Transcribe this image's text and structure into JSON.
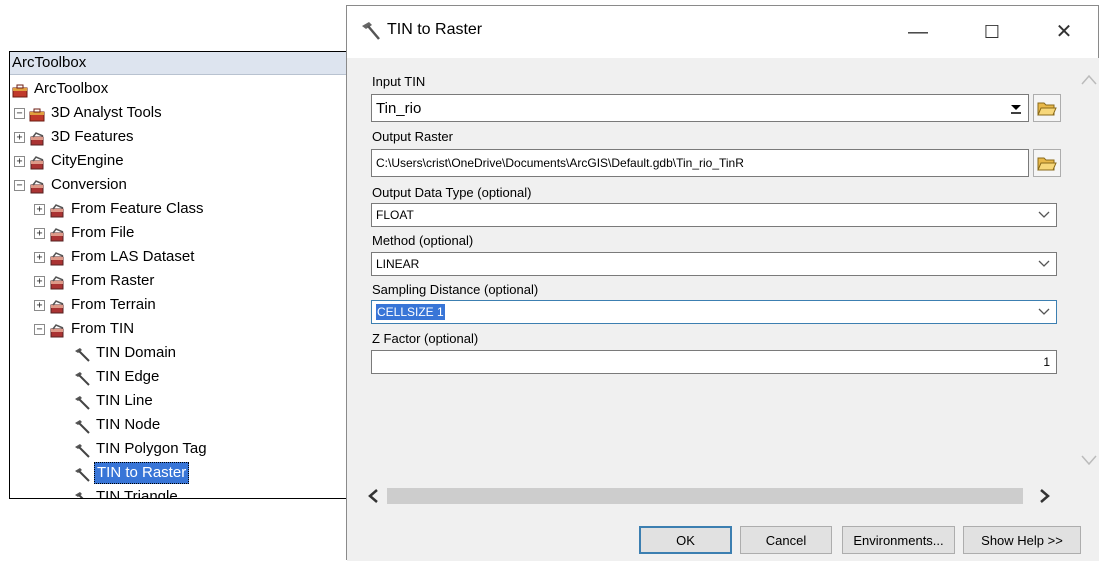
{
  "toolbox": {
    "title": "ArcToolbox",
    "tree": [
      {
        "label": "ArcToolbox",
        "expander": "",
        "icon": "toolbox-icon"
      },
      {
        "label": "3D Analyst Tools",
        "expander": "−",
        "icon": "toolbox-icon"
      },
      {
        "label": "3D Features",
        "expander": "+",
        "icon": "toolset-icon"
      },
      {
        "label": "CityEngine",
        "expander": "+",
        "icon": "toolset-icon"
      },
      {
        "label": "Conversion",
        "expander": "−",
        "icon": "toolset-icon"
      },
      {
        "label": "From Feature Class",
        "expander": "+",
        "icon": "toolset-icon"
      },
      {
        "label": "From File",
        "expander": "+",
        "icon": "toolset-icon"
      },
      {
        "label": "From LAS Dataset",
        "expander": "+",
        "icon": "toolset-icon"
      },
      {
        "label": "From Raster",
        "expander": "+",
        "icon": "toolset-icon"
      },
      {
        "label": "From Terrain",
        "expander": "+",
        "icon": "toolset-icon"
      },
      {
        "label": "From TIN",
        "expander": "−",
        "icon": "toolset-icon"
      },
      {
        "label": "TIN Domain",
        "expander": "",
        "icon": "hammer-icon"
      },
      {
        "label": "TIN Edge",
        "expander": "",
        "icon": "hammer-icon"
      },
      {
        "label": "TIN Line",
        "expander": "",
        "icon": "hammer-icon"
      },
      {
        "label": "TIN Node",
        "expander": "",
        "icon": "hammer-icon"
      },
      {
        "label": "TIN Polygon Tag",
        "expander": "",
        "icon": "hammer-icon"
      },
      {
        "label": "TIN to Raster",
        "expander": "",
        "icon": "hammer-icon",
        "selected": true
      },
      {
        "label": "TIN Triangle",
        "expander": "",
        "icon": "hammer-icon"
      }
    ]
  },
  "dialog": {
    "title": "TIN to Raster",
    "window_controls": {
      "minimize": "—",
      "maximize": "☐",
      "close": "✕"
    },
    "fields": {
      "input_tin": {
        "label": "Input TIN",
        "value": "Tin_rio"
      },
      "output_raster": {
        "label": "Output Raster",
        "value": "C:\\Users\\crist\\OneDrive\\Documents\\ArcGIS\\Default.gdb\\Tin_rio_TinR"
      },
      "output_data_type": {
        "label": "Output Data Type (optional)",
        "value": "FLOAT"
      },
      "method": {
        "label": "Method (optional)",
        "value": "LINEAR"
      },
      "sampling_distance": {
        "label": "Sampling Distance (optional)",
        "value": "CELLSIZE 1"
      },
      "z_factor": {
        "label": "Z Factor (optional)",
        "value": "1"
      }
    },
    "buttons": {
      "ok": "OK",
      "cancel": "Cancel",
      "environments": "Environments...",
      "show_help": "Show Help >>"
    }
  },
  "colors": {
    "selection": "#3875d7",
    "panel_title": "#dde4ef",
    "dialog_bg": "#f0f0f0",
    "default_button_border": "#3c7fb1"
  }
}
